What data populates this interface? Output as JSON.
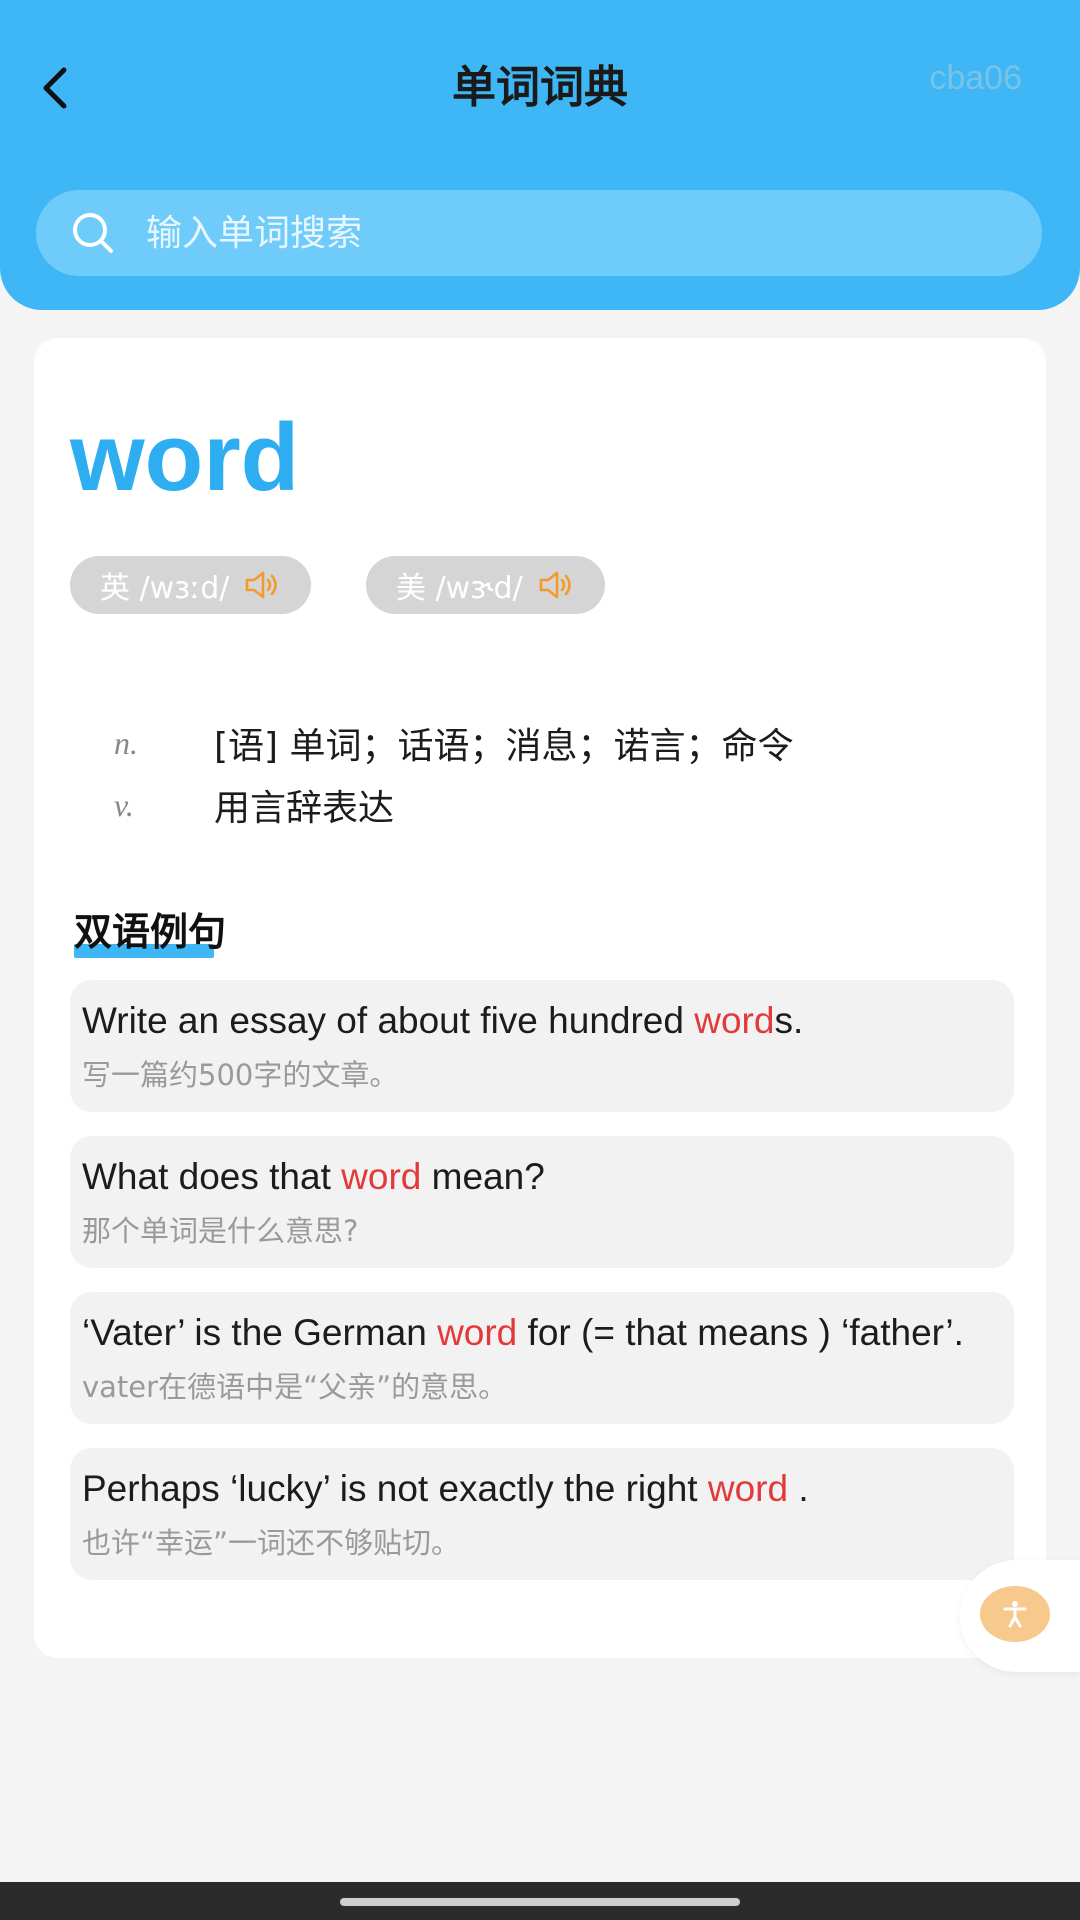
{
  "header": {
    "title": "单词词典",
    "watermark": "cba06",
    "search_placeholder": "输入单词搜索"
  },
  "colors": {
    "header_bg": "#3fb7f6",
    "headword": "#2eaef0",
    "highlight": "#e23a3a",
    "speaker": "#f39a2b",
    "fab": "#f7c98d"
  },
  "icons": {
    "back": "chevron-left-icon",
    "search": "search-icon",
    "speaker": "speaker-icon",
    "accessibility": "accessibility-icon"
  },
  "entry": {
    "word": "word",
    "pronunciations": [
      {
        "label": "英 /wɜːd/"
      },
      {
        "label": "美 /wɝd/"
      }
    ],
    "definitions": [
      {
        "pos": "n.",
        "meaning": "[语] 单词；话语；消息；诺言；命令"
      },
      {
        "pos": "v.",
        "meaning": "用言辞表达"
      }
    ]
  },
  "examples_section": {
    "title": "双语例句",
    "items": [
      {
        "en_before": "Write an essay of about five hundred ",
        "en_highlight": "word",
        "en_after": "s.",
        "zh": "写一篇约500字的文章。"
      },
      {
        "en_before": "What does that ",
        "en_highlight": "word",
        "en_after": " mean?",
        "zh": "那个单词是什么意思?"
      },
      {
        "en_before": "‘Vater’ is the German ",
        "en_highlight": "word",
        "en_after": " for (= that means ) ‘father’.",
        "zh": "vater在德语中是“父亲”的意思。"
      },
      {
        "en_before": "Perhaps ‘lucky’ is not exactly the right ",
        "en_highlight": "word",
        "en_after": " .",
        "zh": "也许“幸运”一词还不够贴切。"
      }
    ]
  }
}
